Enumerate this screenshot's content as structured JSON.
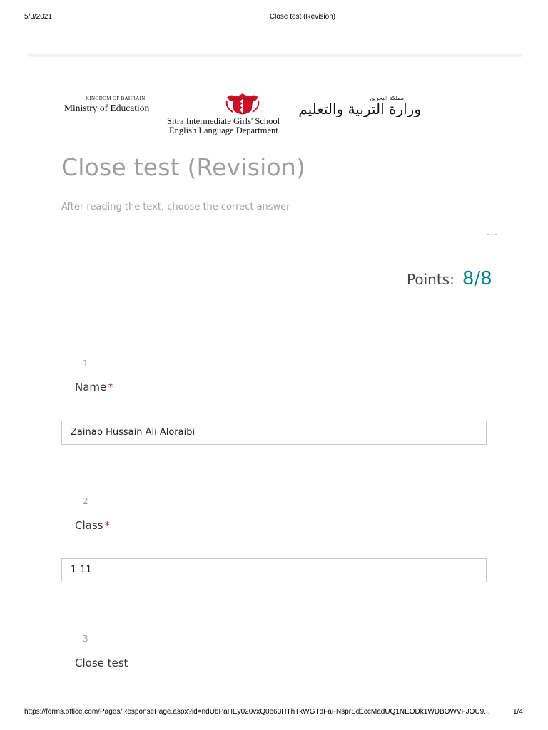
{
  "print_header": {
    "date": "5/3/2021",
    "title": "Close test (Revision)"
  },
  "banner": {
    "kingdom": "KINGDOM OF BAHRAIN",
    "ministry": "Ministry of Education",
    "arabic": "وزارة التربية والتعليم",
    "arabic_small": "مملكة البحرين",
    "school": "Sitra Intermediate Girls' School",
    "department": "English Language Department"
  },
  "form": {
    "title": "Close test (Revision)",
    "description": "After reading the text, choose the correct answer",
    "more_icon": "···",
    "points_label": "Points:",
    "points_value": "8/8"
  },
  "questions": [
    {
      "number": "1",
      "title": "Name",
      "required_mark": "*",
      "answer": "Zainab Hussain Ali Aloraibi"
    },
    {
      "number": "2",
      "title": "Class",
      "required_mark": "*",
      "answer": "1-11"
    },
    {
      "number": "3",
      "title": "Close test"
    }
  ],
  "print_footer": {
    "url": "https://forms.office.com/Pages/ResponsePage.aspx?id=ndUbPaHEy020vxQ0e63HThTkWGTdFaFNsprSd1ccMadUQ1NEODk1WDBOWVFJOU9...",
    "page": "1/4"
  },
  "colors": {
    "accent": "#038387",
    "required": "#a4262c",
    "title_gray": "#9e9e9e",
    "crest_red": "#ce1126"
  }
}
